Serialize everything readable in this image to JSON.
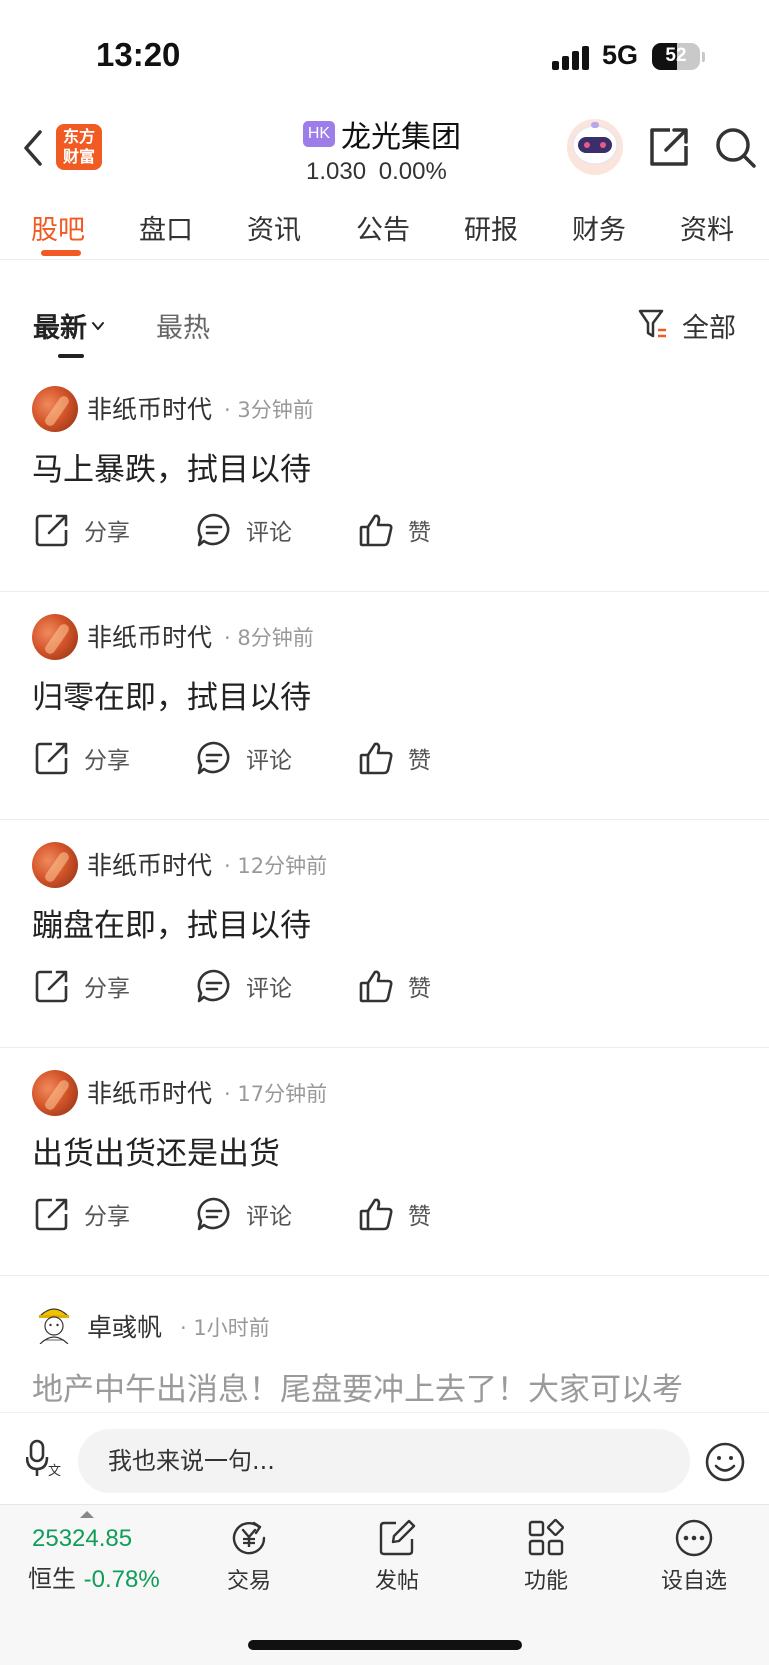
{
  "status_bar": {
    "time": "13:20",
    "network": "5G",
    "battery_level": "52",
    "battery_fraction": 0.52
  },
  "header": {
    "logo_text": "东方\n财富",
    "market_badge": "HK",
    "stock_name": "龙光集团",
    "price_line": "1.030  0.00%"
  },
  "tabs": [
    {
      "label": "股吧",
      "active": true
    },
    {
      "label": "盘口"
    },
    {
      "label": "资讯"
    },
    {
      "label": "公告"
    },
    {
      "label": "研报"
    },
    {
      "label": "财务"
    },
    {
      "label": "资料"
    }
  ],
  "sort": {
    "latest": "最新",
    "hot": "最热",
    "filter": "全部"
  },
  "posts": [
    {
      "author": "非纸币时代",
      "time": "3分钟前",
      "text": "马上暴跌，拭目以待"
    },
    {
      "author": "非纸币时代",
      "time": "8分钟前",
      "text": "归零在即，拭目以待"
    },
    {
      "author": "非纸币时代",
      "time": "12分钟前",
      "text": "蹦盘在即，拭目以待"
    },
    {
      "author": "非纸币时代",
      "time": "17分钟前",
      "text": "出货出货还是出货"
    },
    {
      "author": "卓彧帆",
      "time": "1小时前",
      "text": "地产中午出消息！尾盘要冲上去了！大家可以考"
    }
  ],
  "actions": {
    "share": "分享",
    "comment": "评论",
    "like": "赞"
  },
  "comment_bar": {
    "placeholder": "我也来说一句..."
  },
  "bottom_bar": {
    "index_value": "25324.85",
    "index_name": "恒生",
    "index_change": "-0.78%",
    "items": [
      {
        "label": "交易",
        "icon": "trade-yen-icon"
      },
      {
        "label": "发帖",
        "icon": "compose-icon"
      },
      {
        "label": "功能",
        "icon": "grid-icon"
      },
      {
        "label": "设自选",
        "icon": "more-circle-icon"
      }
    ]
  },
  "colors": {
    "accent": "#f15a22",
    "down_green": "#0f9d58",
    "hk_badge": "#9d7de7"
  }
}
